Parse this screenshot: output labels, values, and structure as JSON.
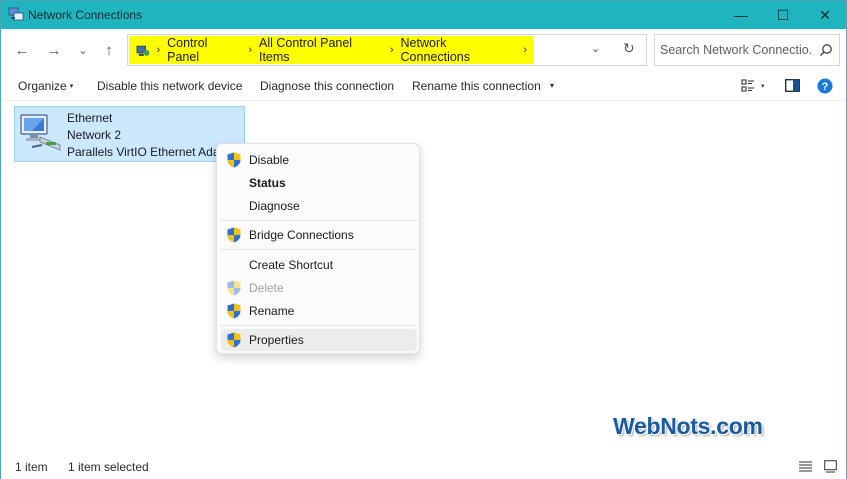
{
  "window": {
    "title": "Network Connections",
    "min_glyph": "—",
    "max_glyph": "☐",
    "close_glyph": "✕"
  },
  "nav": {
    "back_glyph": "←",
    "forward_glyph": "→",
    "recent_glyph": "⌄",
    "up_glyph": "↑"
  },
  "address": {
    "separator": "›",
    "crumbs": [
      "Control Panel",
      "All Control Panel Items",
      "Network Connections"
    ],
    "dropdown_glyph": "⌄",
    "refresh_glyph": "↻",
    "highlight_color": "#ffff00"
  },
  "search": {
    "placeholder": "Search Network Connectio..."
  },
  "commands": {
    "organize": "Organize",
    "disable": "Disable this network device",
    "diagnose": "Diagnose this connection",
    "rename": "Rename this connection",
    "more_glyph": "▾",
    "caret_glyph": "▾"
  },
  "connection": {
    "name": "Ethernet",
    "network": "Network 2",
    "adapter": "Parallels VirtIO Ethernet Ada"
  },
  "context_menu": {
    "disable": "Disable",
    "status": "Status",
    "diagnose": "Diagnose",
    "bridge": "Bridge Connections",
    "shortcut": "Create Shortcut",
    "delete": "Delete",
    "rename": "Rename",
    "properties": "Properties"
  },
  "watermark": "WebNots.com",
  "status": {
    "count": "1 item",
    "selected": "1 item selected"
  },
  "colors": {
    "titlebar": "#20b4bf",
    "selection_bg": "#cce8ff",
    "selection_border": "#99d1ff",
    "help_blue": "#1a78d6"
  }
}
